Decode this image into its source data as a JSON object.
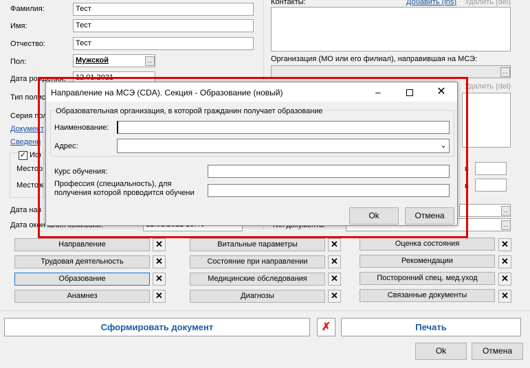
{
  "form": {
    "surname_label": "Фамилия:",
    "surname_value": "Тест",
    "name_label": "Имя:",
    "name_value": "Тест",
    "patronymic_label": "Отчество:",
    "patronymic_value": "Тест",
    "sex_label": "Пол:",
    "sex_value": "Мужской",
    "birthdate_label": "Дата рождения:",
    "birthdate_value": "12.01.2021",
    "type_label": "Тип полиса",
    "series_label": "Серия пол",
    "documents_link": "Документ",
    "info_link": "Сведени",
    "check_label": "Иф",
    "place1_label": "Местор",
    "place2_label": "Местож",
    "date_start_label": "Дата нач",
    "date_end_label": "Дата окончания комиссии:",
    "date_end_value": "12.01.2021 13:46",
    "doc_type_label": "Тип документа:",
    "contacts_label": "Контакты:",
    "add_link": "Добавить (ins)",
    "delete_link": "Удалить (del)",
    "org_label": "Организация (МО или его филиал), направившая на МСЭ:",
    "delete_link2": "Удалить (del)",
    "right_label_k1": "в",
    "right_label_k2": "в"
  },
  "panel": {
    "col1": [
      "Направление",
      "Трудовая деятельность",
      "Образование",
      "Анамнез"
    ],
    "col2": [
      "Витальные параметры",
      "Состояние при направлении",
      "Медицинские обследования",
      "Диагнозы"
    ],
    "col3": [
      "Оценка состояния",
      "Рекомендации",
      "Посторонний спец. мед.уход",
      "Связанные документы"
    ]
  },
  "actions": {
    "generate": "Сформировать документ",
    "print": "Печать",
    "ok": "Ok",
    "cancel": "Отмена"
  },
  "dialog": {
    "title": "Направление на МСЭ (CDA). Секция - Образование (новый)",
    "group_title": "Образовательная организация, в которой гражданин получает образование",
    "name_label": "Наименование:",
    "name_value": "",
    "address_label": "Адрес:",
    "address_value": "",
    "course_label": "Курс обучения:",
    "course_value": "",
    "profession_label_1": "Профессия (специальность), для",
    "profession_label_2": "получения  которой  проводится обучени",
    "profession_value": "",
    "ok": "Ok",
    "cancel": "Отмена"
  },
  "colors": {
    "highlight": "#e00000",
    "accent": "#1a73d9",
    "link": "#1a4fa0"
  }
}
